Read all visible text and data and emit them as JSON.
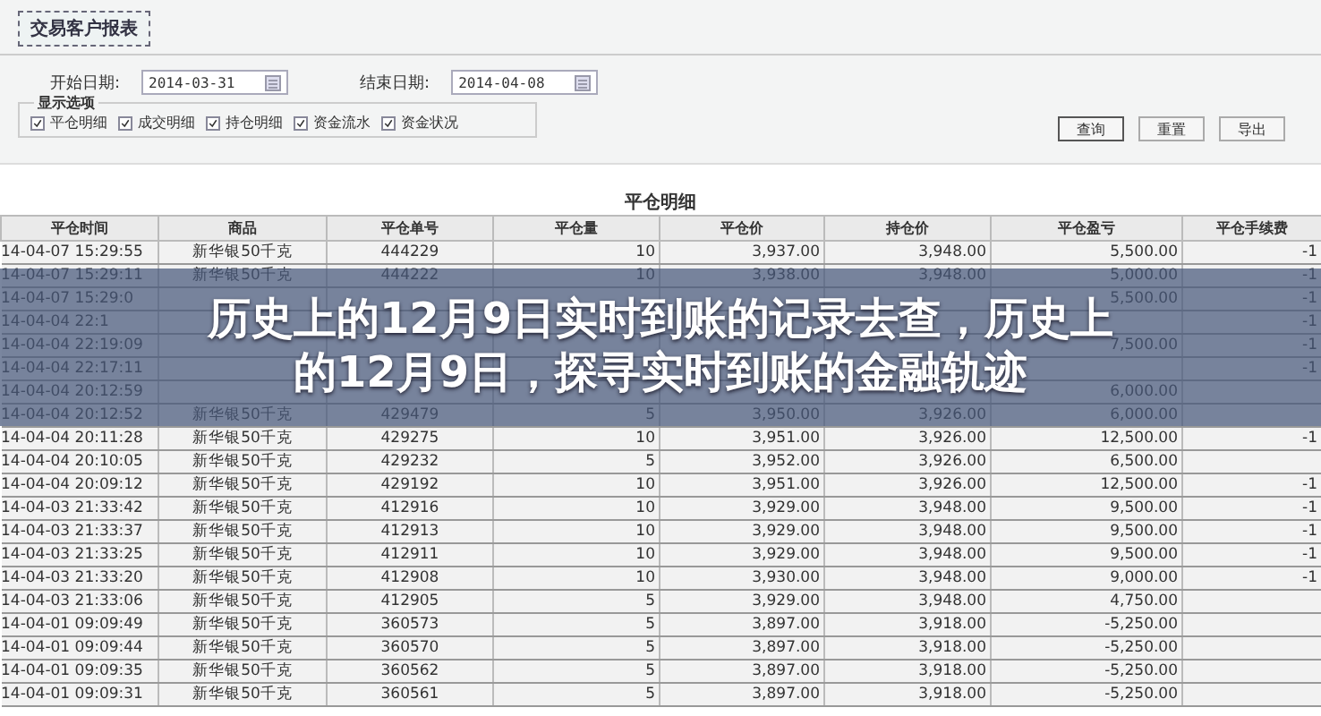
{
  "panel_tab": {
    "label": "交易客户报表"
  },
  "date_fields": [
    {
      "label": "开始日期:",
      "value": "2014-03-31"
    },
    {
      "label": "结束日期:",
      "value": "2014-04-08"
    }
  ],
  "display_options": {
    "title": "显示选项",
    "options": [
      {
        "label": "平仓明细",
        "checked": true
      },
      {
        "label": "成交明细",
        "checked": true
      },
      {
        "label": "持仓明细",
        "checked": true
      },
      {
        "label": "资金流水",
        "checked": true
      },
      {
        "label": "资金状况",
        "checked": true
      }
    ]
  },
  "buttons": [
    {
      "label": "查询",
      "selected": true
    },
    {
      "label": "重置",
      "selected": false
    },
    {
      "label": "导出",
      "selected": false
    }
  ],
  "table": {
    "title": "平仓明细",
    "columns": [
      "平仓时间",
      "商品",
      "平仓单号",
      "平仓量",
      "平仓价",
      "持仓价",
      "平仓盈亏",
      "平仓手续费"
    ],
    "rows": [
      [
        "14-04-07 15:29:55",
        "新华银50千克",
        "444229",
        "10",
        "3,937.00",
        "3,948.00",
        "5,500.00",
        "-1"
      ],
      [
        "14-04-07 15:29:11",
        "新华银50千克",
        "444222",
        "10",
        "3,938.00",
        "3,948.00",
        "5,000.00",
        "-1"
      ],
      [
        "14-04-07 15:29:0",
        null,
        null,
        null,
        null,
        null,
        "5,500.00",
        "-1"
      ],
      [
        "14-04-04 22:1",
        null,
        null,
        null,
        null,
        null,
        null,
        "-1"
      ],
      [
        "14-04-04 22:19:09",
        null,
        null,
        null,
        null,
        null,
        "7,500.00",
        "-1"
      ],
      [
        "14-04-04 22:17:11",
        null,
        null,
        null,
        null,
        null,
        null,
        "-1"
      ],
      [
        "14-04-04 20:12:59",
        null,
        null,
        null,
        null,
        null,
        "6,000.00",
        null
      ],
      [
        "14-04-04 20:12:52",
        "新华银50千克",
        "429479",
        "5",
        "3,950.00",
        "3,926.00",
        "6,000.00",
        null
      ],
      [
        "14-04-04 20:11:28",
        "新华银50千克",
        "429275",
        "10",
        "3,951.00",
        "3,926.00",
        "12,500.00",
        "-1"
      ],
      [
        "14-04-04 20:10:05",
        "新华银50千克",
        "429232",
        "5",
        "3,952.00",
        "3,926.00",
        "6,500.00",
        null
      ],
      [
        "14-04-04 20:09:12",
        "新华银50千克",
        "429192",
        "10",
        "3,951.00",
        "3,926.00",
        "12,500.00",
        "-1"
      ],
      [
        "14-04-03 21:33:42",
        "新华银50千克",
        "412916",
        "10",
        "3,929.00",
        "3,948.00",
        "9,500.00",
        "-1"
      ],
      [
        "14-04-03 21:33:37",
        "新华银50千克",
        "412913",
        "10",
        "3,929.00",
        "3,948.00",
        "9,500.00",
        "-1"
      ],
      [
        "14-04-03 21:33:25",
        "新华银50千克",
        "412911",
        "10",
        "3,929.00",
        "3,948.00",
        "9,500.00",
        "-1"
      ],
      [
        "14-04-03 21:33:20",
        "新华银50千克",
        "412908",
        "10",
        "3,930.00",
        "3,948.00",
        "9,000.00",
        "-1"
      ],
      [
        "14-04-03 21:33:06",
        "新华银50千克",
        "412905",
        "5",
        "3,929.00",
        "3,948.00",
        "4,750.00",
        null
      ],
      [
        "14-04-01 09:09:49",
        "新华银50千克",
        "360573",
        "5",
        "3,897.00",
        "3,918.00",
        "-5,250.00",
        null
      ],
      [
        "14-04-01 09:09:44",
        "新华银50千克",
        "360570",
        "5",
        "3,897.00",
        "3,918.00",
        "-5,250.00",
        null
      ],
      [
        "14-04-01 09:09:35",
        "新华银50千克",
        "360562",
        "5",
        "3,897.00",
        "3,918.00",
        "-5,250.00",
        null
      ],
      [
        "14-04-01 09:09:31",
        "新华银50千克",
        "360561",
        "5",
        "3,897.00",
        "3,918.00",
        "-5,250.00",
        null
      ]
    ]
  },
  "headline": {
    "lines": [
      "历史上的12月9日实时到账的记录去查，历史上",
      "的12月9日，探寻实时到账的金融轨迹"
    ]
  }
}
